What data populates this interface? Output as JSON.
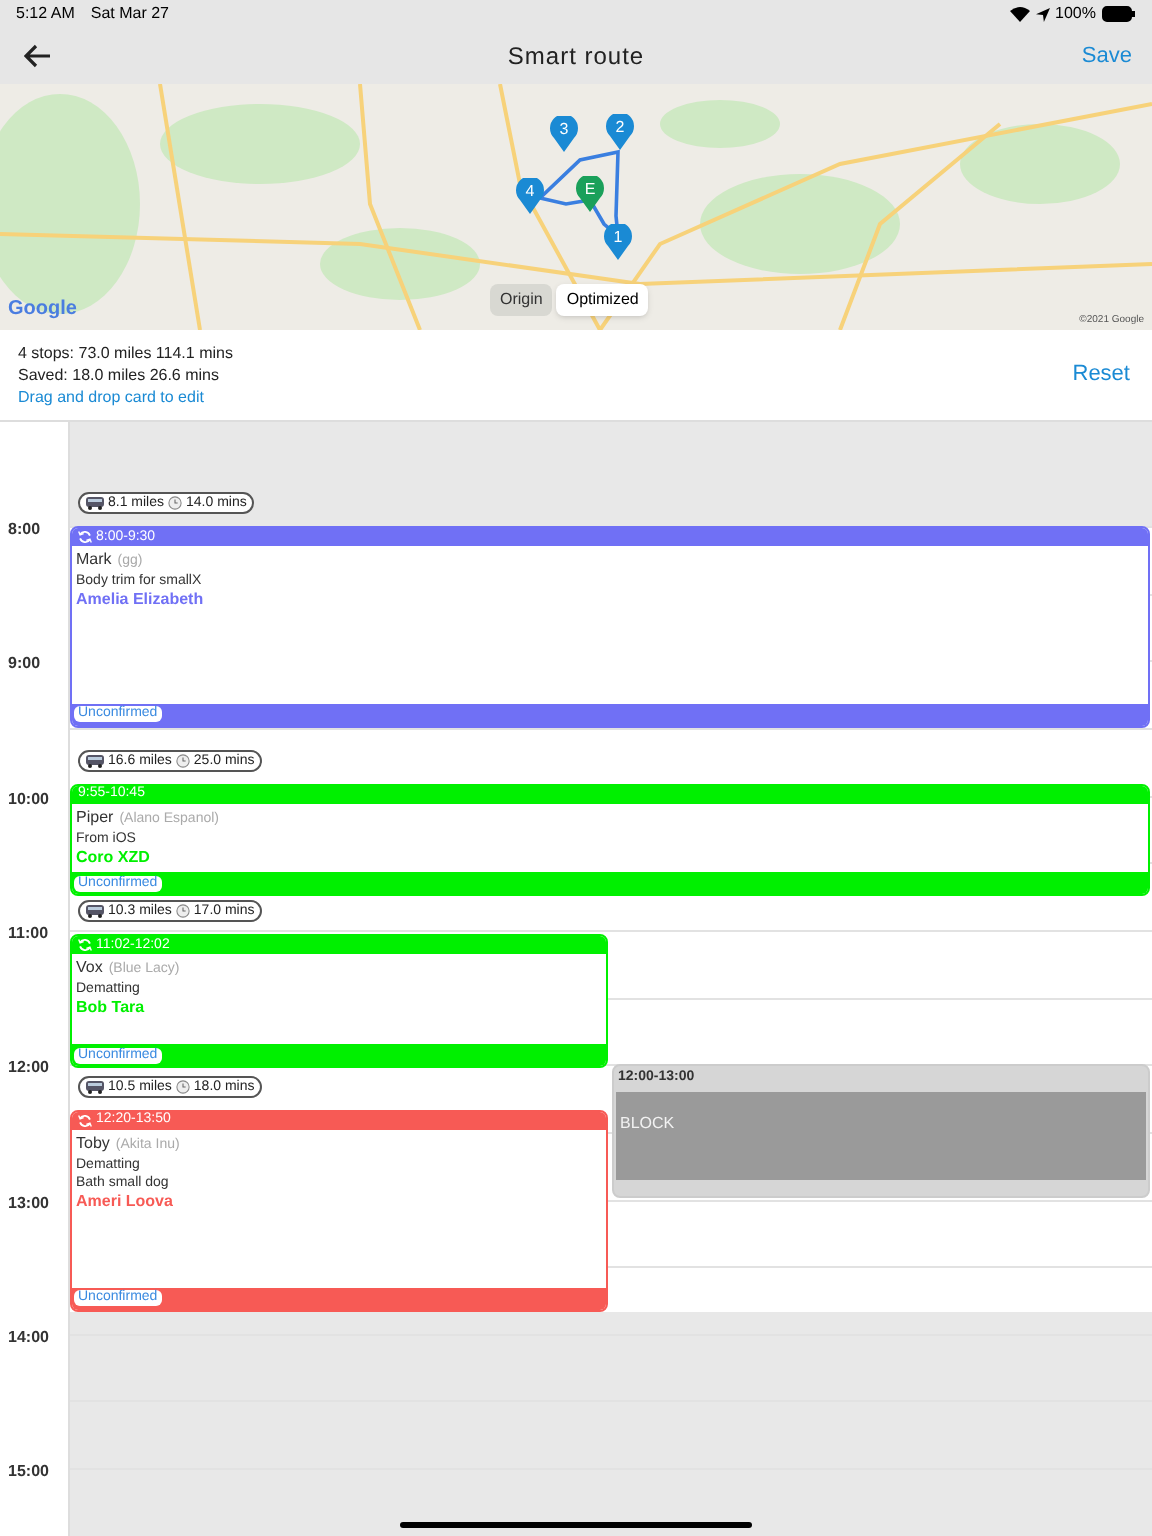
{
  "status_bar": {
    "time": "5:12 AM",
    "date": "Sat Mar 27",
    "battery": "100%"
  },
  "nav": {
    "title": "Smart route",
    "action": "Save"
  },
  "map": {
    "pins": [
      {
        "label": "3",
        "kind": "stop"
      },
      {
        "label": "2",
        "kind": "stop"
      },
      {
        "label": "4",
        "kind": "stop"
      },
      {
        "label": "E",
        "kind": "end"
      },
      {
        "label": "1",
        "kind": "stop"
      }
    ],
    "modes": [
      {
        "label": "Origin",
        "selected": false
      },
      {
        "label": "Optimized",
        "selected": true
      }
    ],
    "logo": "Google",
    "copyright": "©2021 Google"
  },
  "summary": {
    "stops": "4 stops: 73.0 miles 114.1 mins",
    "saved": "Saved: 18.0 miles 26.6 mins",
    "hint": "Drag and drop card to edit",
    "reset": "Reset"
  },
  "calendar": {
    "hours": [
      "8:00",
      "9:00",
      "10:00",
      "11:00",
      "12:00",
      "13:00",
      "14:00",
      "15:00"
    ],
    "events": [
      {
        "kind": "appointment",
        "time": "8:00-9:30",
        "recurring": true,
        "color": "#7070f5",
        "name": "Mark",
        "breed": "(gg)",
        "lines": [
          "Body trim for smallX"
        ],
        "client": "Amelia Elizabeth",
        "status": "Unconfirmed",
        "travel": {
          "distance": "8.1 miles",
          "duration": "14.0 mins"
        }
      },
      {
        "kind": "appointment",
        "time": "9:55-10:45",
        "recurring": false,
        "color": "#00f000",
        "name": "Piper",
        "breed": "(Alano Espanol)",
        "lines": [
          "From iOS"
        ],
        "client": "Coro XZD",
        "status": "Unconfirmed",
        "travel": {
          "distance": "16.6 miles",
          "duration": "25.0 mins"
        }
      },
      {
        "kind": "appointment",
        "time": "11:02-12:02",
        "recurring": true,
        "color": "#00f000",
        "name": "Vox",
        "breed": "(Blue Lacy)",
        "lines": [
          "Dematting"
        ],
        "client": "Bob Tara",
        "status": "Unconfirmed",
        "travel": {
          "distance": "10.3 miles",
          "duration": "17.0 mins"
        }
      },
      {
        "kind": "appointment",
        "time": "12:20-13:50",
        "recurring": true,
        "color": "#f75a55",
        "name": "Toby",
        "breed": "(Akita Inu)",
        "lines": [
          "Dematting",
          "Bath small dog"
        ],
        "client": "Ameri Loova",
        "status": "Unconfirmed",
        "travel": {
          "distance": "10.5 miles",
          "duration": "18.0 mins"
        }
      },
      {
        "kind": "block",
        "time": "12:00-13:00",
        "label": "BLOCK"
      }
    ]
  }
}
